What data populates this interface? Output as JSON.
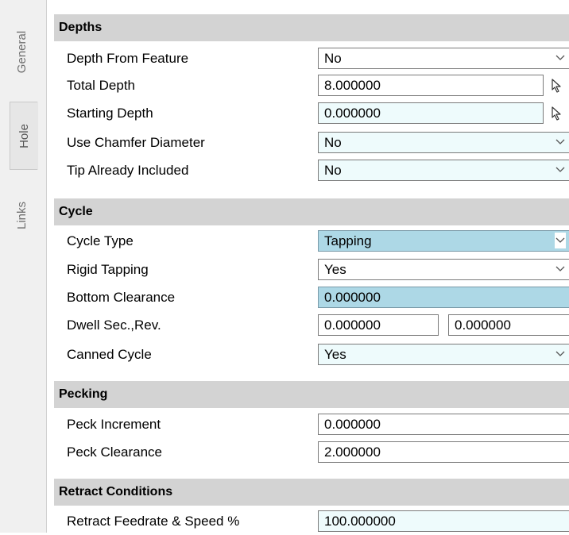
{
  "tabs": [
    {
      "label": "General"
    },
    {
      "label": "Hole"
    },
    {
      "label": "Links"
    }
  ],
  "sections": {
    "depths": {
      "title": "Depths",
      "depth_from_feature": {
        "label": "Depth From Feature",
        "value": "No"
      },
      "total_depth": {
        "label": "Total Depth",
        "value": "8.000000"
      },
      "starting_depth": {
        "label": "Starting Depth",
        "value": "0.000000"
      },
      "use_chamfer_diameter": {
        "label": "Use Chamfer Diameter",
        "value": "No"
      },
      "tip_already_included": {
        "label": "Tip Already Included",
        "value": "No"
      }
    },
    "cycle": {
      "title": "Cycle",
      "cycle_type": {
        "label": "Cycle Type",
        "value": "Tapping"
      },
      "rigid_tapping": {
        "label": "Rigid Tapping",
        "value": "Yes"
      },
      "bottom_clearance": {
        "label": "Bottom Clearance",
        "value": "0.000000"
      },
      "dwell": {
        "label": "Dwell Sec.,Rev.",
        "sec": "0.000000",
        "rev": "0.000000"
      },
      "canned_cycle": {
        "label": "Canned Cycle",
        "value": "Yes"
      }
    },
    "pecking": {
      "title": "Pecking",
      "peck_increment": {
        "label": "Peck Increment",
        "value": "0.000000"
      },
      "peck_clearance": {
        "label": "Peck Clearance",
        "value": "2.000000"
      }
    },
    "retract": {
      "title": "Retract Conditions",
      "retract_feedrate": {
        "label": "Retract Feedrate & Speed %",
        "value": "100.000000"
      }
    }
  },
  "icons": {
    "dropdown": "chevron-down-icon",
    "pick": "cursor-pick-icon"
  },
  "colors": {
    "section_header_bg": "#d3d3d3",
    "selected_field_bg": "#add8e6",
    "tinted_field_bg": "#eefbfc",
    "tab_text": "#6f6f6f"
  }
}
